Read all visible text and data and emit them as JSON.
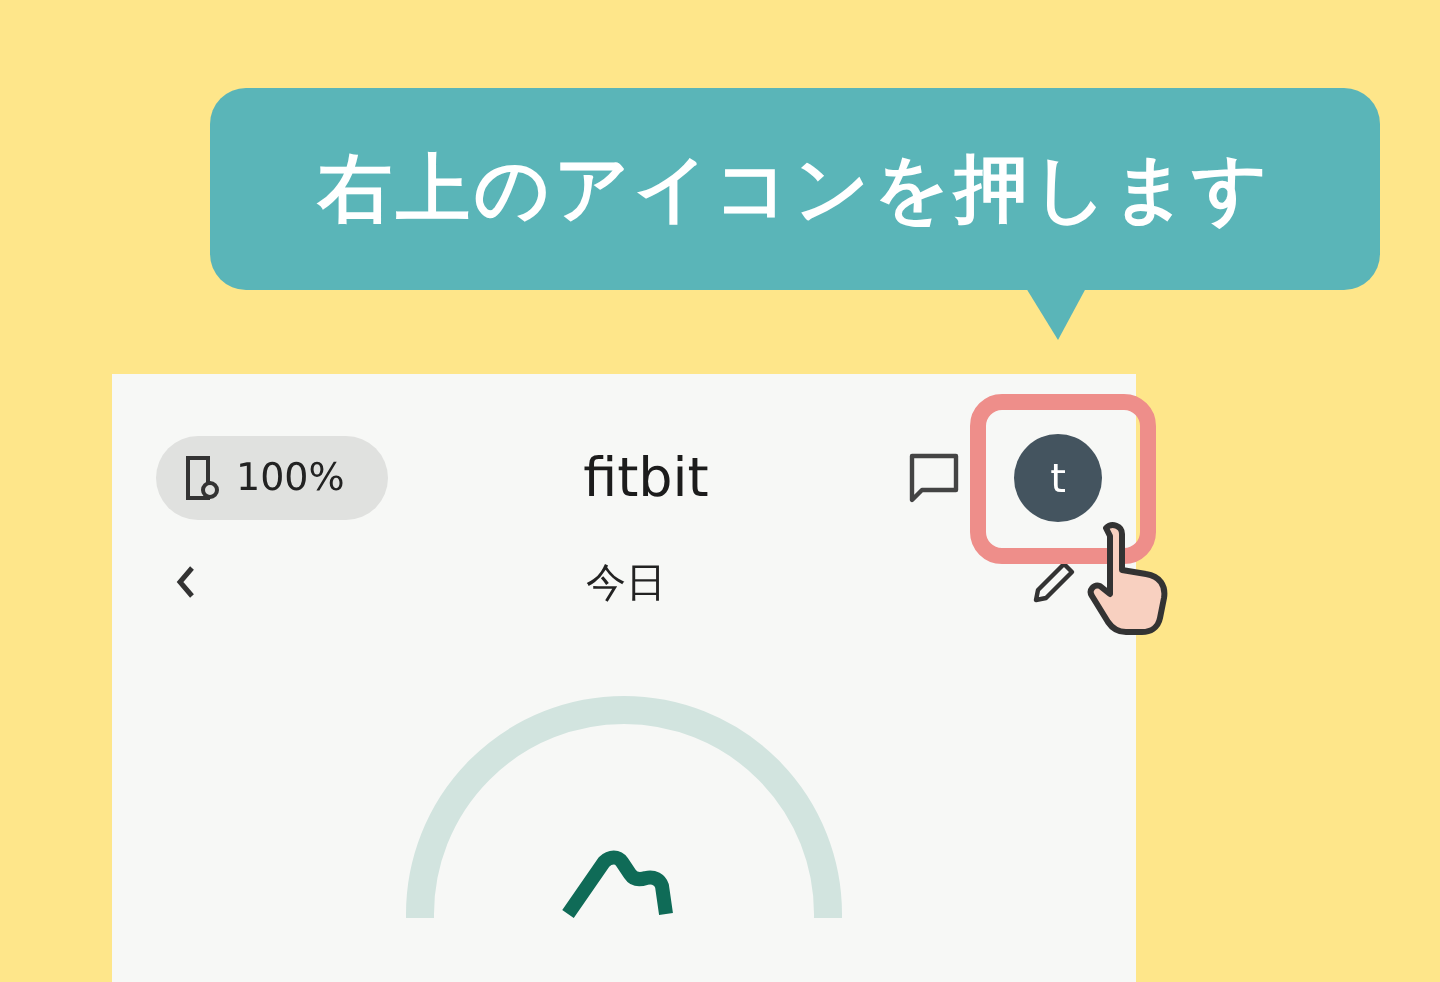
{
  "callout": {
    "text": "右上のアイコンを押します"
  },
  "header": {
    "battery": "100%",
    "title": "fitbit",
    "avatar": "t"
  },
  "date_bar": {
    "label": "今日"
  }
}
